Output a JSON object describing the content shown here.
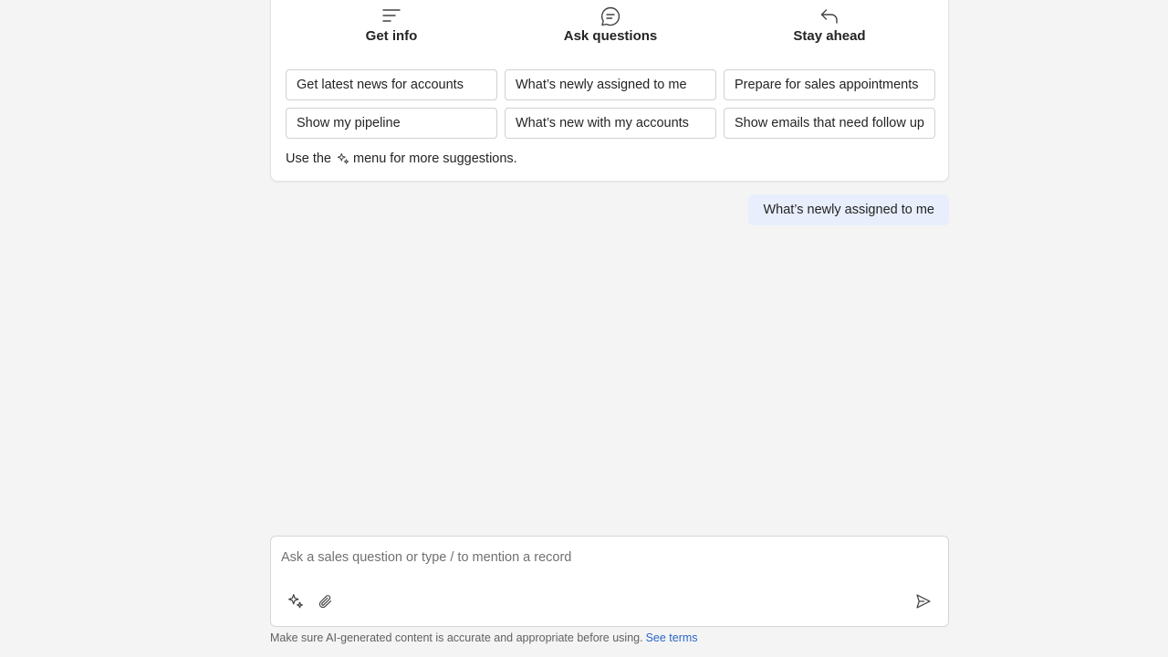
{
  "suggestions_card": {
    "cutoff_intro": "…",
    "columns": [
      {
        "title": "Get info",
        "icon": "text-lines-icon",
        "prompts": [
          "Get latest news for accounts",
          "Show my pipeline"
        ]
      },
      {
        "title": "Ask questions",
        "icon": "chat-bubble-icon",
        "prompts": [
          "What’s newly assigned to me",
          "What’s new with my accounts"
        ]
      },
      {
        "title": "Stay ahead",
        "icon": "reply-arrow-icon",
        "prompts": [
          "Prepare for sales appointments",
          "Show emails that need follow up"
        ]
      }
    ],
    "hint_prefix": "Use the",
    "hint_icon": "sparkle-icon",
    "hint_suffix": "menu for more suggestions."
  },
  "conversation": {
    "user_message": "What’s newly assigned to me"
  },
  "composer": {
    "placeholder": "Ask a sales question or type / to mention a record",
    "value": "",
    "prompt_menu_icon": "sparkle-icon",
    "attach_icon": "paperclip-icon",
    "send_icon": "send-icon"
  },
  "footer": {
    "disclaimer": "Make sure AI-generated content is accurate and appropriate before using.",
    "terms_link": "See terms"
  },
  "colors": {
    "page_background": "#f4f4f4",
    "card_background": "#ffffff",
    "user_bubble": "#e8eefb",
    "link": "#2a67c9"
  }
}
